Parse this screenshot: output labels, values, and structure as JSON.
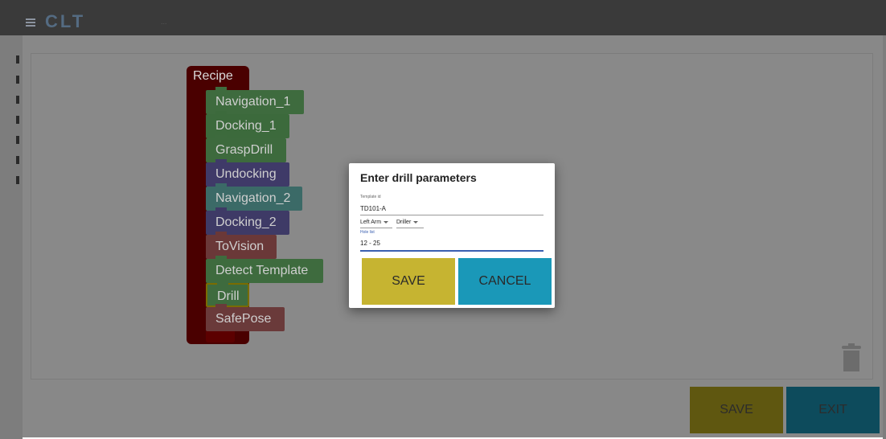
{
  "app": {
    "logo": "CLT",
    "name": "..."
  },
  "recipe": {
    "title": "Recipe",
    "blocks": [
      {
        "label": "Navigation_1",
        "color": "#3e6b3e"
      },
      {
        "label": "Docking_1",
        "color": "#3c6a3c"
      },
      {
        "label": "GraspDrill",
        "color": "#3d6a3d"
      },
      {
        "label": "Undocking",
        "color": "#3f3a68"
      },
      {
        "label": "Navigation_2",
        "color": "#3b6a67"
      },
      {
        "label": "Docking_2",
        "color": "#3e3a66"
      },
      {
        "label": "ToVision",
        "color": "#6a3838"
      },
      {
        "label": "Detect Template",
        "color": "#3e6b3e"
      },
      {
        "label": "Drill",
        "color": "#3e6b3e",
        "selected": true
      },
      {
        "label": "SafePose",
        "color": "#6a3a3a"
      }
    ]
  },
  "footer": {
    "save_label": "SAVE",
    "exit_label": "EXIT"
  },
  "dialog": {
    "title": "Enter drill parameters",
    "template_id_label": "Template id",
    "template_id_value": "TD101-A",
    "arm_select": "Left Arm",
    "tool_select": "Driller",
    "hole_list_label": "Hole list",
    "hole_list_value": "12 - 25",
    "save_label": "SAVE",
    "cancel_label": "CANCEL"
  },
  "colors": {
    "save": "#c6b431",
    "cancel": "#1a98b8"
  },
  "icons": {
    "menu": "menu-icon",
    "trash": "trash-icon"
  }
}
